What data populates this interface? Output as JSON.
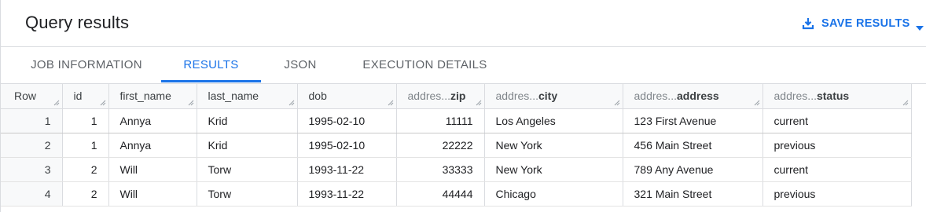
{
  "header": {
    "title": "Query results",
    "save_results_label": "SAVE RESULTS"
  },
  "tabs": [
    {
      "label": "JOB INFORMATION",
      "active": false
    },
    {
      "label": "RESULTS",
      "active": true
    },
    {
      "label": "JSON",
      "active": false
    },
    {
      "label": "EXECUTION DETAILS",
      "active": false
    }
  ],
  "table": {
    "columns": {
      "row": "Row",
      "id": "id",
      "first_name": "first_name",
      "last_name": "last_name",
      "dob": "dob",
      "zip_prefix": "addres...",
      "zip_field": "zip",
      "city_prefix": "addres...",
      "city_field": "city",
      "address_prefix": "addres...",
      "address_field": "address",
      "status_prefix": "addres...",
      "status_field": "status"
    },
    "rows": [
      {
        "row": "1",
        "id": "1",
        "first_name": "Annya",
        "last_name": "Krid",
        "dob": "1995-02-10",
        "zip": "11111",
        "city": "Los Angeles",
        "address": "123 First Avenue",
        "status": "current"
      },
      {
        "row": "2",
        "id": "1",
        "first_name": "Annya",
        "last_name": "Krid",
        "dob": "1995-02-10",
        "zip": "22222",
        "city": "New York",
        "address": "456 Main Street",
        "status": "previous"
      },
      {
        "row": "3",
        "id": "2",
        "first_name": "Will",
        "last_name": "Torw",
        "dob": "1993-11-22",
        "zip": "33333",
        "city": "New York",
        "address": "789 Any Avenue",
        "status": "current"
      },
      {
        "row": "4",
        "id": "2",
        "first_name": "Will",
        "last_name": "Torw",
        "dob": "1993-11-22",
        "zip": "44444",
        "city": "Chicago",
        "address": "321 Main Street",
        "status": "previous"
      }
    ]
  },
  "colors": {
    "accent": "#1a73e8",
    "tab_inactive": "#5f6368",
    "header_bg": "#f8f9fa",
    "border": "#dadce0"
  },
  "icons": {
    "save": "download-icon",
    "dropdown": "caret-down-icon",
    "column_resize": "resize-handle-icon"
  }
}
